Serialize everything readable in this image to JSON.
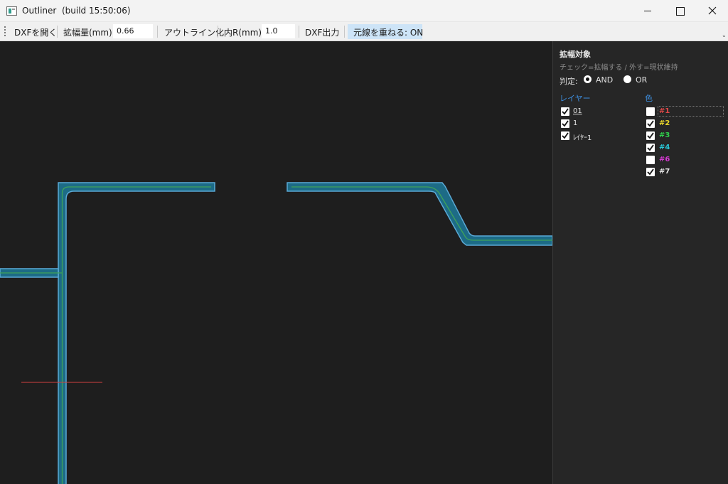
{
  "window": {
    "title": "Outliner  (build 15:50:06)"
  },
  "toolbar": {
    "open_dxf": "DXFを開く",
    "expand_label": "拡幅量(mm):",
    "expand_value": "0.66",
    "outline": "アウトライン化",
    "inner_r_label": "内R(mm):",
    "inner_r_value": "1.0",
    "dxf_out": "DXF出力",
    "overlay_toggle": "元線を重ねる: ON"
  },
  "panel": {
    "title": "拡幅対象",
    "hint": "チェック=拡幅する / 外す=現状維持",
    "mode_label": "判定:",
    "mode_options": [
      {
        "label": "AND",
        "selected": true
      },
      {
        "label": "OR",
        "selected": false
      }
    ],
    "layers_heading": "レイヤー",
    "colors_heading": "色",
    "layers": [
      {
        "name": "01",
        "checked": true
      },
      {
        "name": "1",
        "checked": true
      },
      {
        "name": "ﾚｲﾔｰ1",
        "checked": true
      }
    ],
    "colors": [
      {
        "name": "#1",
        "checked": false,
        "color": "#e04848"
      },
      {
        "name": "#2",
        "checked": true,
        "color": "#e8d52a"
      },
      {
        "name": "#3",
        "checked": true,
        "color": "#2fd14b"
      },
      {
        "name": "#4",
        "checked": true,
        "color": "#29c8d8"
      },
      {
        "name": "#6",
        "checked": false,
        "color": "#d43ad0"
      },
      {
        "name": "#7",
        "checked": true,
        "color": "#e6e6e6"
      }
    ]
  },
  "canvas": {
    "outline_color": "#5aa9d6",
    "fill_color": "#1d6b86",
    "centerline_color": "#3fa35a",
    "cursor_color": "#d04040"
  }
}
